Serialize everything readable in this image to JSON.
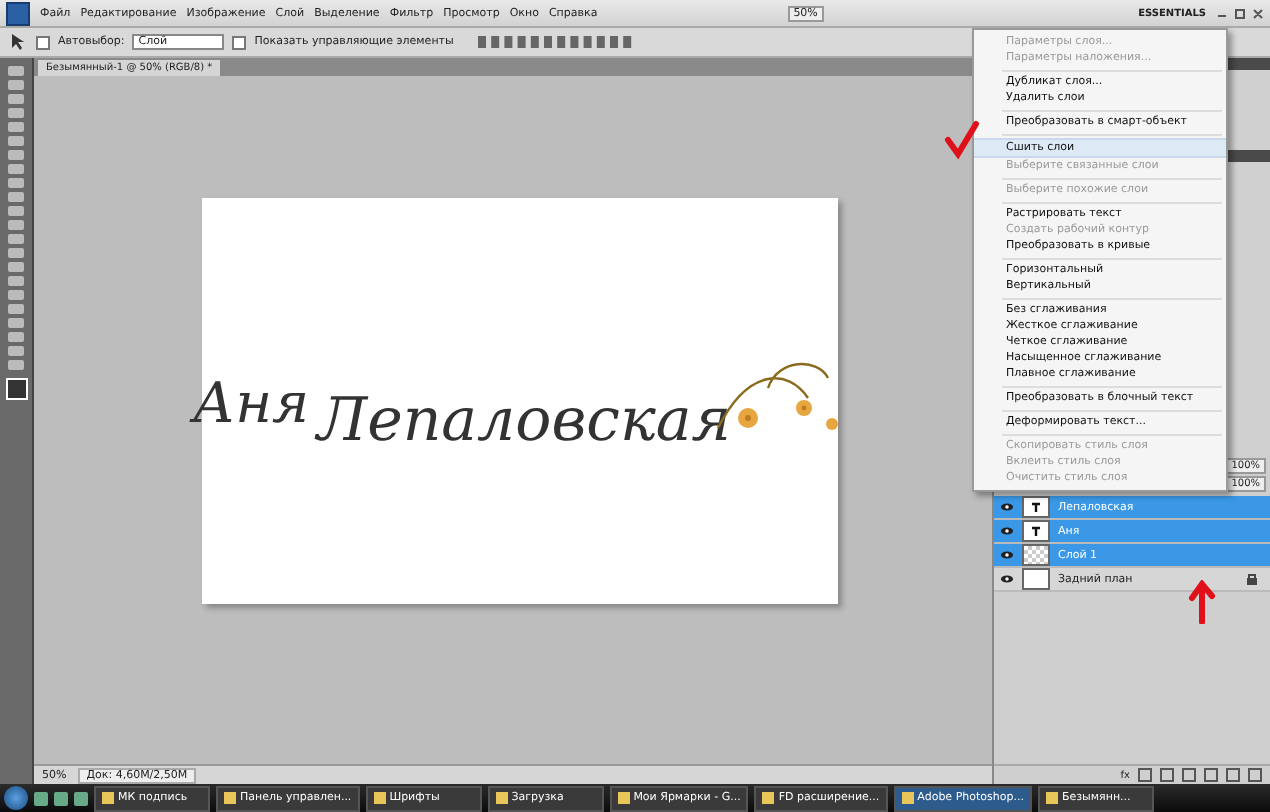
{
  "menu_bar": {
    "items": [
      "Файл",
      "Редактирование",
      "Изображение",
      "Слой",
      "Выделение",
      "Фильтр",
      "Просмотр",
      "Окно",
      "Справка"
    ],
    "zoom": "50%",
    "workspace": "ESSENTIALS"
  },
  "options_bar": {
    "auto_select": {
      "label": "Автовыбор:",
      "checked": false
    },
    "target": "Слой",
    "transform_controls": {
      "label": "Показать управляющие элементы",
      "checked": false
    }
  },
  "document_tab": {
    "title": "Безымянный-1 @ 50% (RGB/8) *"
  },
  "canvas": {
    "text_1": "Аня",
    "text_2": "Лепаловская"
  },
  "status_bar": {
    "zoom": "50%",
    "doc_size": "Док: 4,60M/2,50M"
  },
  "context_menu": [
    {
      "kind": "item",
      "label": "Параметры слоя...",
      "disabled": true,
      "selected": false
    },
    {
      "kind": "item",
      "label": "Параметры наложения...",
      "disabled": true,
      "selected": false
    },
    {
      "kind": "separator"
    },
    {
      "kind": "item",
      "label": "Дубликат слоя...",
      "disabled": false,
      "selected": false
    },
    {
      "kind": "item",
      "label": "Удалить слои",
      "disabled": false,
      "selected": false
    },
    {
      "kind": "separator"
    },
    {
      "kind": "item",
      "label": "Преобразовать в смарт-объект",
      "disabled": false,
      "selected": false
    },
    {
      "kind": "separator"
    },
    {
      "kind": "item",
      "label": "Сшить слои",
      "disabled": false,
      "selected": true
    },
    {
      "kind": "item",
      "label": "Выберите связанные слои",
      "disabled": true,
      "selected": false
    },
    {
      "kind": "separator"
    },
    {
      "kind": "item",
      "label": "Выберите похожие слои",
      "disabled": true,
      "selected": false
    },
    {
      "kind": "separator"
    },
    {
      "kind": "item",
      "label": "Растрировать текст",
      "disabled": false,
      "selected": false
    },
    {
      "kind": "item",
      "label": "Создать рабочий контур",
      "disabled": true,
      "selected": false
    },
    {
      "kind": "item",
      "label": "Преобразовать в кривые",
      "disabled": false,
      "selected": false
    },
    {
      "kind": "separator"
    },
    {
      "kind": "item",
      "label": "Горизонтальный",
      "disabled": false,
      "selected": false
    },
    {
      "kind": "item",
      "label": "Вертикальный",
      "disabled": false,
      "selected": false
    },
    {
      "kind": "separator"
    },
    {
      "kind": "item",
      "label": "Без сглаживания",
      "disabled": false,
      "selected": false
    },
    {
      "kind": "item",
      "label": "Жесткое сглаживание",
      "disabled": false,
      "selected": false
    },
    {
      "kind": "item",
      "label": "Четкое сглаживание",
      "disabled": false,
      "selected": false
    },
    {
      "kind": "item",
      "label": "Насыщенное сглаживание",
      "disabled": false,
      "selected": false
    },
    {
      "kind": "item",
      "label": "Плавное сглаживание",
      "disabled": false,
      "selected": false
    },
    {
      "kind": "separator"
    },
    {
      "kind": "item",
      "label": "Преобразовать в блочный текст",
      "disabled": false,
      "selected": false
    },
    {
      "kind": "separator"
    },
    {
      "kind": "item",
      "label": "Деформировать текст...",
      "disabled": false,
      "selected": false
    },
    {
      "kind": "separator"
    },
    {
      "kind": "item",
      "label": "Скопировать стиль слоя",
      "disabled": true,
      "selected": false
    },
    {
      "kind": "item",
      "label": "Вклеить стиль слоя",
      "disabled": true,
      "selected": false
    },
    {
      "kind": "item",
      "label": "Очистить стиль слоя",
      "disabled": true,
      "selected": false
    }
  ],
  "layers_panel": {
    "opacity": "100%",
    "fill": "100%",
    "layers": [
      {
        "kind": "text",
        "name": "Лепаловская",
        "selected": true,
        "visible": true
      },
      {
        "kind": "text",
        "name": "Аня",
        "selected": true,
        "visible": true
      },
      {
        "kind": "pixel",
        "name": "Слой 1",
        "selected": true,
        "visible": true
      },
      {
        "kind": "background",
        "name": "Задний план",
        "selected": false,
        "visible": true
      }
    ],
    "link_label": "fx"
  },
  "taskbar": {
    "items": [
      {
        "label": "МК подпись",
        "selected": false
      },
      {
        "label": "Панель управлен...",
        "selected": false
      },
      {
        "label": "Шрифты",
        "selected": false
      },
      {
        "label": "Загрузка",
        "selected": false
      },
      {
        "label": "Мои Ярмарки - G...",
        "selected": false
      },
      {
        "label": "FD расширение...",
        "selected": false
      },
      {
        "label": "Adobe Photoshop...",
        "selected": true
      },
      {
        "label": "Безымянн...",
        "selected": false
      }
    ]
  }
}
